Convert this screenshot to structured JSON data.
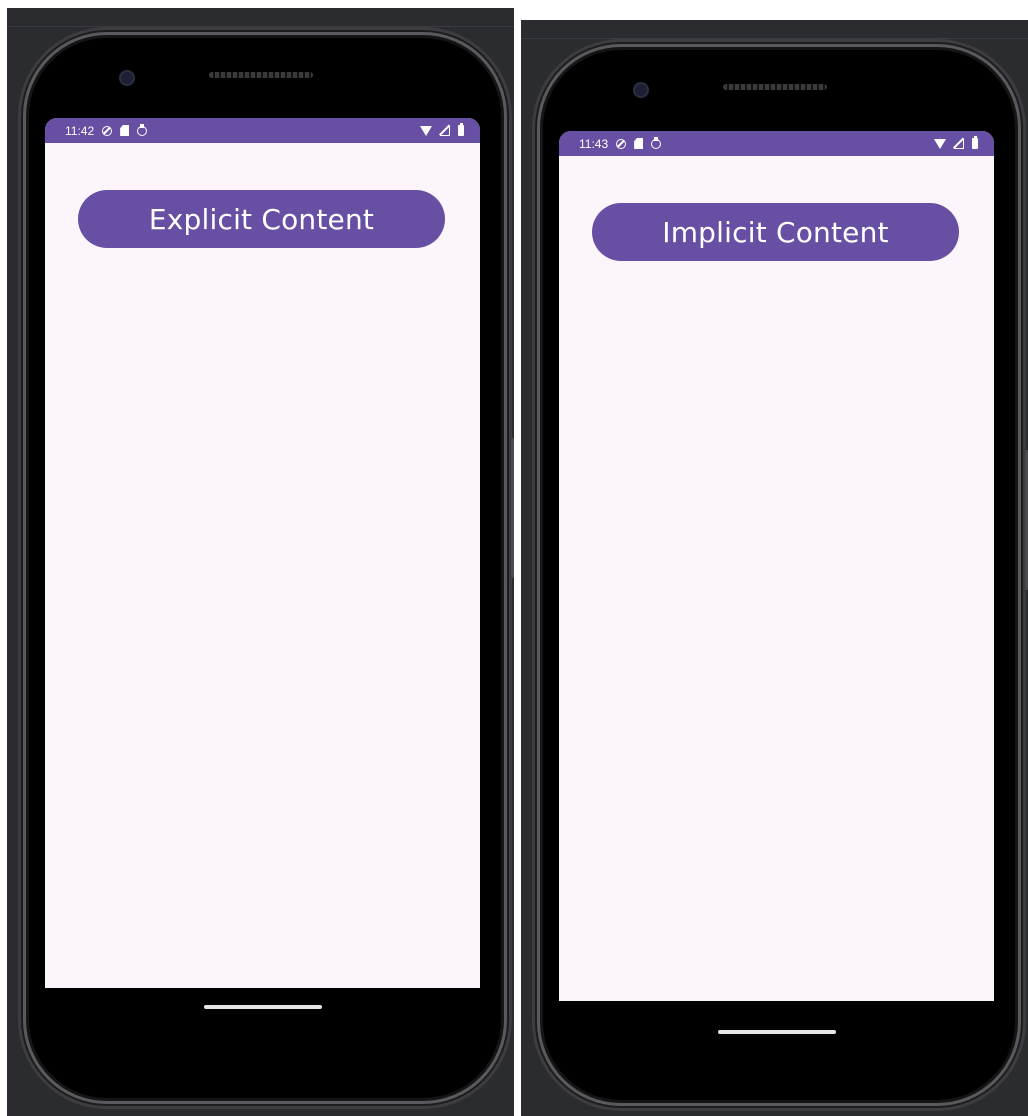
{
  "screens": [
    {
      "status_time": "11:42",
      "button_label": "Explicit Content"
    },
    {
      "status_time": "11:43",
      "button_label": "Implicit Content"
    }
  ],
  "colors": {
    "primary": "#6750a4",
    "surface": "#fcf6fc",
    "bezel": "#000000",
    "emulator_bg": "#2b2c30"
  },
  "status_icons": [
    "alarm-icon",
    "sim-card-icon",
    "sync-icon",
    "wifi-icon",
    "cell-signal-icon",
    "battery-icon"
  ]
}
